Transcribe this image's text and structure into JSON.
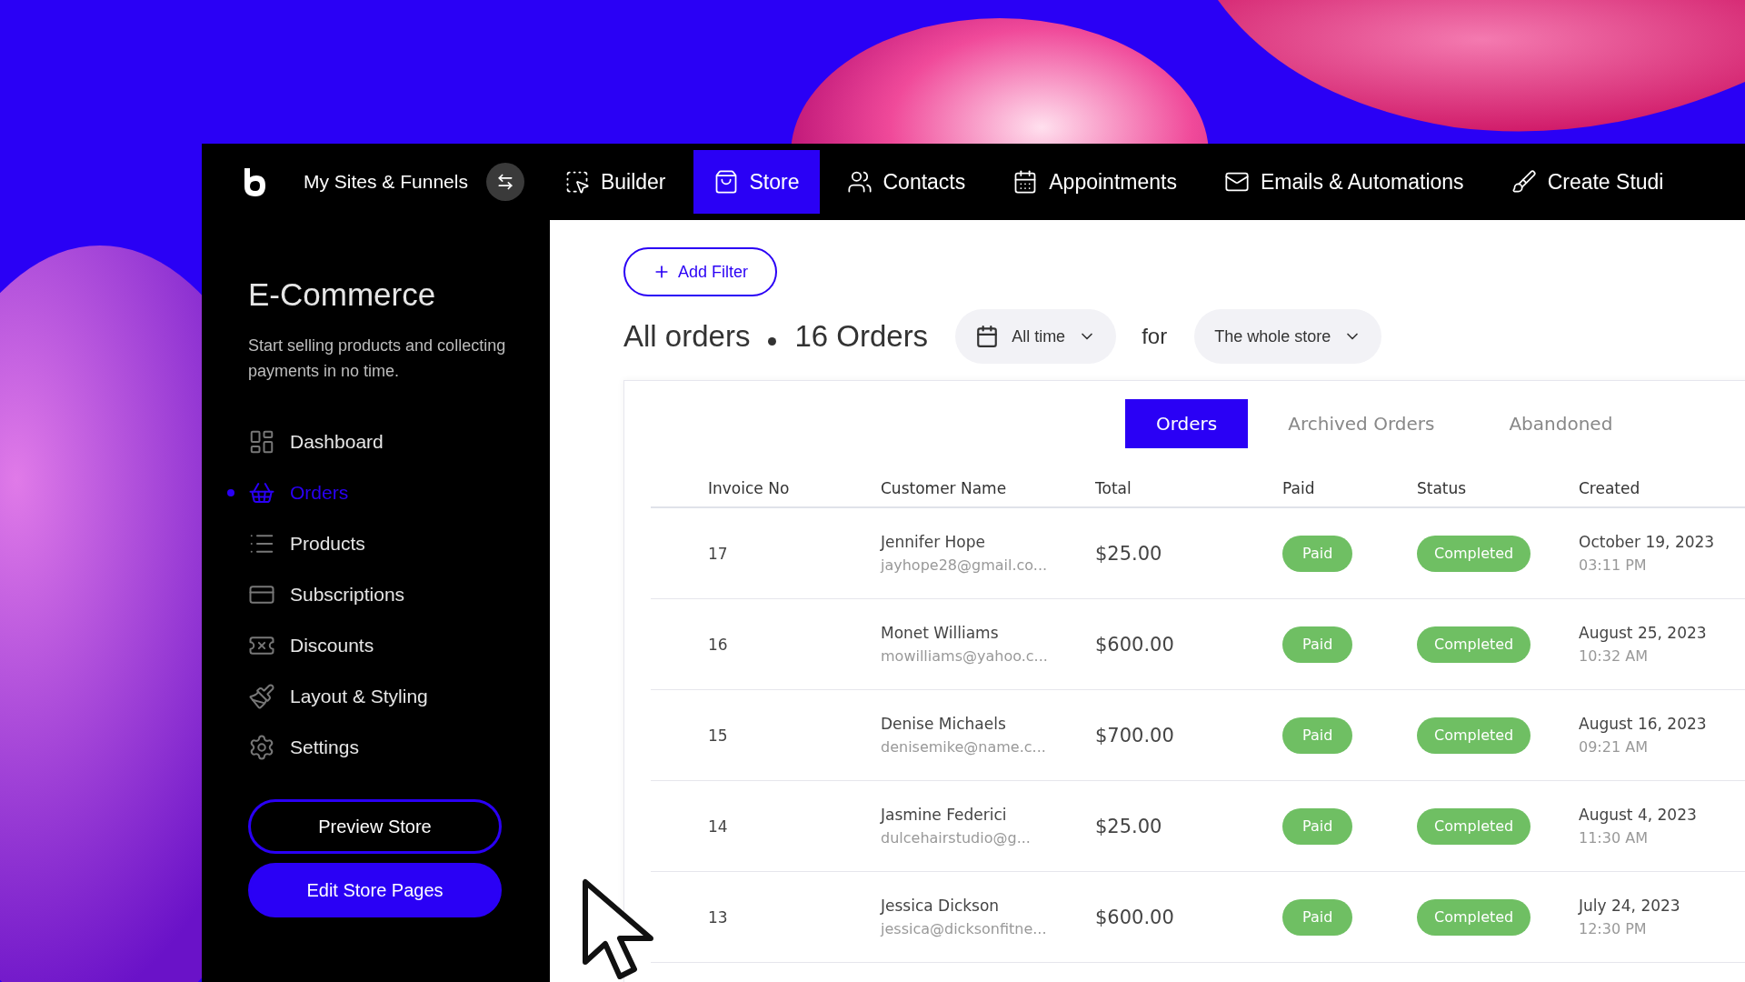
{
  "top_nav": {
    "site_switcher": "My Sites & Funnels",
    "items": [
      {
        "label": "Builder",
        "selected": false
      },
      {
        "label": "Store",
        "selected": true
      },
      {
        "label": "Contacts",
        "selected": false
      },
      {
        "label": "Appointments",
        "selected": false
      },
      {
        "label": "Emails & Automations",
        "selected": false
      },
      {
        "label": "Create Studi",
        "selected": false
      }
    ]
  },
  "sidebar": {
    "title": "E-Commerce",
    "description": "Start selling products and collecting payments in no time.",
    "items": [
      {
        "label": "Dashboard",
        "selected": false
      },
      {
        "label": "Orders",
        "selected": true
      },
      {
        "label": "Products",
        "selected": false
      },
      {
        "label": "Subscriptions",
        "selected": false
      },
      {
        "label": "Discounts",
        "selected": false
      },
      {
        "label": "Layout & Styling",
        "selected": false
      },
      {
        "label": "Settings",
        "selected": false
      }
    ],
    "buttons": [
      "Preview Store",
      "Edit Store Pages"
    ]
  },
  "toolbar": {
    "add_filter": "Add Filter",
    "heading": "All orders",
    "count": "16 Orders",
    "period": "All time",
    "for_label": "for",
    "scope": "The whole store"
  },
  "tabs": [
    {
      "label": "Orders",
      "selected": true
    },
    {
      "label": "Archived Orders",
      "selected": false
    },
    {
      "label": "Abandoned",
      "selected": false
    }
  ],
  "table": {
    "columns": [
      "Invoice No",
      "Customer Name",
      "Total",
      "Paid",
      "Status",
      "Created"
    ],
    "rows": [
      {
        "invoice": "17",
        "name": "Jennifer Hope",
        "email": "jayhope28@gmail.co...",
        "total": "$25.00",
        "paid": "Paid",
        "status": "Completed",
        "date": "October 19, 2023",
        "time": "03:11 PM"
      },
      {
        "invoice": "16",
        "name": "Monet Williams",
        "email": "mowilliams@yahoo.c...",
        "total": "$600.00",
        "paid": "Paid",
        "status": "Completed",
        "date": "August 25, 2023",
        "time": "10:32 AM"
      },
      {
        "invoice": "15",
        "name": "Denise Michaels",
        "email": "denisemike@name.c...",
        "total": "$700.00",
        "paid": "Paid",
        "status": "Completed",
        "date": "August 16, 2023",
        "time": "09:21 AM"
      },
      {
        "invoice": "14",
        "name": "Jasmine Federici",
        "email": "dulcehairstudio@g...",
        "total": "$25.00",
        "paid": "Paid",
        "status": "Completed",
        "date": "August 4, 2023",
        "time": "11:30 AM"
      },
      {
        "invoice": "13",
        "name": "Jessica Dickson",
        "email": "jessica@dicksonfitne...",
        "total": "$600.00",
        "paid": "Paid",
        "status": "Completed",
        "date": "July 24, 2023",
        "time": "12:30 PM"
      }
    ]
  }
}
